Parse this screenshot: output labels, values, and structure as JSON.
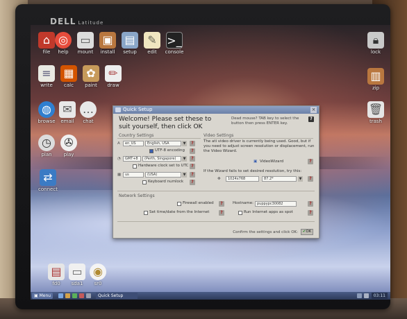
{
  "brand": {
    "name": "DELL",
    "model": "Latitude"
  },
  "desktop": {
    "icons": [
      {
        "label": "file",
        "icon": "house-icon"
      },
      {
        "label": "help",
        "icon": "lifebuoy-icon"
      },
      {
        "label": "mount",
        "icon": "drive-icon"
      },
      {
        "label": "install",
        "icon": "box-icon"
      },
      {
        "label": "setup",
        "icon": "monitor-icon"
      },
      {
        "label": "edit",
        "icon": "notepad-icon"
      },
      {
        "label": "console",
        "icon": "terminal-icon"
      },
      {
        "label": "write",
        "icon": "document-icon"
      },
      {
        "label": "calc",
        "icon": "spreadsheet-icon"
      },
      {
        "label": "paint",
        "icon": "palette-icon"
      },
      {
        "label": "draw",
        "icon": "pencil-icon"
      },
      {
        "label": "browse",
        "icon": "globe-icon"
      },
      {
        "label": "email",
        "icon": "envelope-icon"
      },
      {
        "label": "chat",
        "icon": "speech-bubble-icon"
      },
      {
        "label": "plan",
        "icon": "clock-icon"
      },
      {
        "label": "play",
        "icon": "film-reel-icon"
      },
      {
        "label": "connect",
        "icon": "network-icon"
      },
      {
        "label": "lock",
        "icon": "padlock-icon"
      },
      {
        "label": "zip",
        "icon": "archive-icon"
      },
      {
        "label": "trash",
        "icon": "trash-can-icon"
      },
      {
        "label": "fd0",
        "icon": "floppy-icon"
      },
      {
        "label": "sda1",
        "icon": "disk-icon"
      },
      {
        "label": "sr0",
        "icon": "cdrom-icon"
      }
    ]
  },
  "dialog": {
    "title": "Quick Setup",
    "welcome_line1": "Welcome! Please set these to",
    "welcome_line2": "suit yourself, then click OK",
    "hint": "Dead mouse? TAB key to select the button then press ENTER key.",
    "country": {
      "heading": "Country Settings",
      "locale_code": "en_US",
      "locale_name": "English, USA",
      "utf8_label": "UTF-8 encoding",
      "timezone": "GMT+8",
      "timezone_city": "(Perth, Singapore)",
      "hwclock_label": "Hardware clock set to UTC",
      "keyboard": "us",
      "keyboard_name": "(USA)",
      "numlock_label": "Keyboard numlock"
    },
    "video": {
      "heading": "Video Settings",
      "desc": "The ati video driver is currently being used. Good, but if you need to adjust screen resolution or displacement, run the Video Wizard.",
      "wizard_label": "VideoWizard",
      "resolution_hint": "If the Wizard fails to set desired resolution, try this:",
      "resolution": "1024x768",
      "depth": "87.2*"
    },
    "network": {
      "heading": "Network Settings",
      "firewall_label": "Firewall enabled",
      "hostname_label": "Hostname:",
      "hostname": "puppypc30082",
      "timedate_label": "Set time/date from the Internet",
      "spot_label": "Run Internet apps as spot"
    },
    "confirm": "Confirm the settings and click OK:",
    "ok": "OK"
  },
  "taskbar": {
    "menu": "Menu",
    "task": "Quick Setup",
    "clock": "03:11"
  }
}
